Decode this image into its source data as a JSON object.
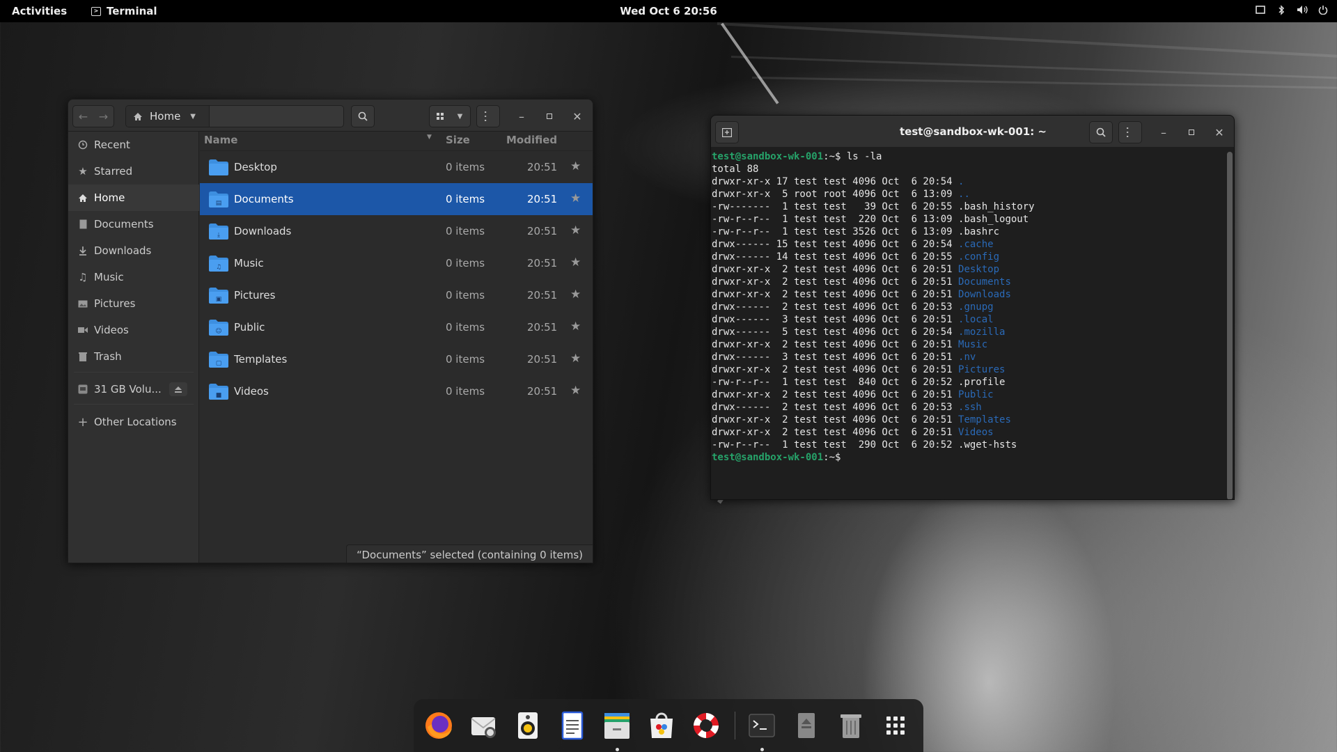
{
  "topbar": {
    "activities": "Activities",
    "app_name": "Terminal",
    "clock": "Wed Oct 6  20:56"
  },
  "files": {
    "path_label": "Home",
    "sidebar": [
      {
        "label": "Recent",
        "icon": "clock-icon"
      },
      {
        "label": "Starred",
        "icon": "star-icon"
      },
      {
        "label": "Home",
        "icon": "home-icon"
      },
      {
        "label": "Documents",
        "icon": "document-icon"
      },
      {
        "label": "Downloads",
        "icon": "download-icon"
      },
      {
        "label": "Music",
        "icon": "music-icon"
      },
      {
        "label": "Pictures",
        "icon": "picture-icon"
      },
      {
        "label": "Videos",
        "icon": "video-icon"
      },
      {
        "label": "Trash",
        "icon": "trash-icon"
      },
      {
        "label": "31 GB Volu...",
        "icon": "drive-icon"
      },
      {
        "label": "Other Locations",
        "icon": "plus-icon"
      }
    ],
    "columns": {
      "name": "Name",
      "size": "Size",
      "modified": "Modified"
    },
    "rows": [
      {
        "name": "Desktop",
        "size": "0 items",
        "modified": "20:51",
        "icon": "desktop-folder-icon"
      },
      {
        "name": "Documents",
        "size": "0 items",
        "modified": "20:51",
        "icon": "documents-folder-icon"
      },
      {
        "name": "Downloads",
        "size": "0 items",
        "modified": "20:51",
        "icon": "downloads-folder-icon"
      },
      {
        "name": "Music",
        "size": "0 items",
        "modified": "20:51",
        "icon": "music-folder-icon"
      },
      {
        "name": "Pictures",
        "size": "0 items",
        "modified": "20:51",
        "icon": "pictures-folder-icon"
      },
      {
        "name": "Public",
        "size": "0 items",
        "modified": "20:51",
        "icon": "public-folder-icon"
      },
      {
        "name": "Templates",
        "size": "0 items",
        "modified": "20:51",
        "icon": "templates-folder-icon"
      },
      {
        "name": "Videos",
        "size": "0 items",
        "modified": "20:51",
        "icon": "videos-folder-icon"
      }
    ],
    "status": "“Documents” selected (containing 0 items)"
  },
  "terminal": {
    "title": "test@sandbox-wk-001: ~",
    "prompt_user": "test@sandbox-wk-001",
    "prompt_path": ":~",
    "prompt_symbol": "$",
    "command": " ls -la",
    "total": "total 88",
    "entries": [
      {
        "meta": "drwxr-xr-x 17 test test 4096 Oct  6 20:54 ",
        "name": ".",
        "kind": "dir"
      },
      {
        "meta": "drwxr-xr-x  5 root root 4096 Oct  6 13:09 ",
        "name": "..",
        "kind": "dir"
      },
      {
        "meta": "-rw-------  1 test test   39 Oct  6 20:55 ",
        "name": ".bash_history",
        "kind": "file"
      },
      {
        "meta": "-rw-r--r--  1 test test  220 Oct  6 13:09 ",
        "name": ".bash_logout",
        "kind": "file"
      },
      {
        "meta": "-rw-r--r--  1 test test 3526 Oct  6 13:09 ",
        "name": ".bashrc",
        "kind": "file"
      },
      {
        "meta": "drwx------ 15 test test 4096 Oct  6 20:54 ",
        "name": ".cache",
        "kind": "dir"
      },
      {
        "meta": "drwx------ 14 test test 4096 Oct  6 20:55 ",
        "name": ".config",
        "kind": "dir"
      },
      {
        "meta": "drwxr-xr-x  2 test test 4096 Oct  6 20:51 ",
        "name": "Desktop",
        "kind": "dir"
      },
      {
        "meta": "drwxr-xr-x  2 test test 4096 Oct  6 20:51 ",
        "name": "Documents",
        "kind": "dir"
      },
      {
        "meta": "drwxr-xr-x  2 test test 4096 Oct  6 20:51 ",
        "name": "Downloads",
        "kind": "dir"
      },
      {
        "meta": "drwx------  2 test test 4096 Oct  6 20:53 ",
        "name": ".gnupg",
        "kind": "dir"
      },
      {
        "meta": "drwx------  3 test test 4096 Oct  6 20:51 ",
        "name": ".local",
        "kind": "dir"
      },
      {
        "meta": "drwx------  5 test test 4096 Oct  6 20:54 ",
        "name": ".mozilla",
        "kind": "dir"
      },
      {
        "meta": "drwxr-xr-x  2 test test 4096 Oct  6 20:51 ",
        "name": "Music",
        "kind": "dir"
      },
      {
        "meta": "drwx------  3 test test 4096 Oct  6 20:51 ",
        "name": ".nv",
        "kind": "dir"
      },
      {
        "meta": "drwxr-xr-x  2 test test 4096 Oct  6 20:51 ",
        "name": "Pictures",
        "kind": "dir"
      },
      {
        "meta": "-rw-r--r--  1 test test  840 Oct  6 20:52 ",
        "name": ".profile",
        "kind": "file"
      },
      {
        "meta": "drwxr-xr-x  2 test test 4096 Oct  6 20:51 ",
        "name": "Public",
        "kind": "dir"
      },
      {
        "meta": "drwx------  2 test test 4096 Oct  6 20:53 ",
        "name": ".ssh",
        "kind": "dir"
      },
      {
        "meta": "drwxr-xr-x  2 test test 4096 Oct  6 20:51 ",
        "name": "Templates",
        "kind": "dir"
      },
      {
        "meta": "drwxr-xr-x  2 test test 4096 Oct  6 20:51 ",
        "name": "Videos",
        "kind": "dir"
      },
      {
        "meta": "-rw-r--r--  1 test test  290 Oct  6 20:52 ",
        "name": ".wget-hsts",
        "kind": "file"
      }
    ]
  },
  "dock": [
    {
      "name": "firefox-icon",
      "running": false
    },
    {
      "name": "mail-icon",
      "running": false
    },
    {
      "name": "rhythmbox-icon",
      "running": false
    },
    {
      "name": "text-editor-icon",
      "running": false
    },
    {
      "name": "files-icon",
      "running": true
    },
    {
      "name": "software-icon",
      "running": false
    },
    {
      "name": "help-icon",
      "running": false
    },
    {
      "name": "terminal-icon",
      "running": true
    },
    {
      "name": "usb-drive-icon",
      "running": false
    },
    {
      "name": "trash-icon",
      "running": false
    },
    {
      "name": "app-grid-icon",
      "running": false
    }
  ],
  "colors": {
    "accent": "#1c57a8",
    "prompt_green": "#26a269",
    "dir_blue": "#2a6ab8",
    "folder_blue": "#3d8fe0"
  }
}
